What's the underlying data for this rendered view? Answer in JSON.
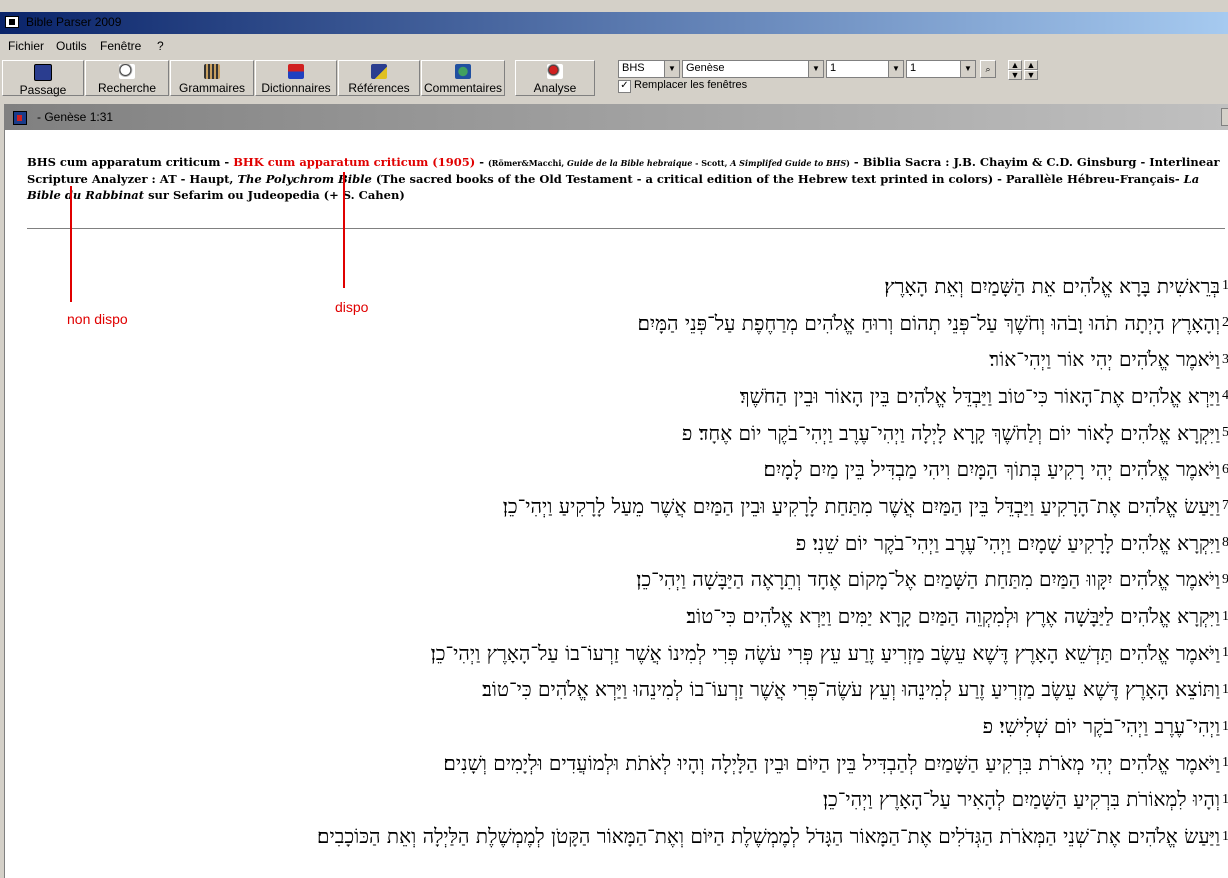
{
  "app": {
    "title": "Bible Parser 2009"
  },
  "menu": [
    "Fichier",
    "Outils",
    "Fenêtre",
    "?"
  ],
  "toolbar": {
    "buttons": [
      "Passage",
      "Recherche",
      "Grammaires",
      "Dictionnaires",
      "Références",
      "Commentaires",
      "Analyse"
    ],
    "version_select": "BHS",
    "book_select": "Genèse",
    "chapter_select": "1",
    "verse_select": "1",
    "replace_windows_label": "Remplacer les fenêtres",
    "replace_windows_checked": true
  },
  "document": {
    "title": "- Genèse 1:31",
    "sources": {
      "s1": "BHS cum apparatum criticum - ",
      "s2": "BHK cum apparatum criticum (1905)",
      "s3": " - ",
      "s4": "(Römer&Macchi, ",
      "s5": "Guide de la Bible hebraique",
      "s6": " - Scott, ",
      "s7": "A Simplifed Guide to BHS",
      "s8": ")",
      "s9": " - Biblia Sacra : J.B. Chayim & C.D. Ginsburg - Interlinear Scripture Analyzer : AT - Haupt, ",
      "s10": "The Polychrom Bible",
      "s11": " (The sacred books of the Old Testament - a critical edition of the Hebrew text printed in colors) - Parallèle Hébreu-Français- ",
      "s12": "La Bible du Rabbinat",
      "s13": " sur Sefarim ou Judeopedia (+ S. Cahen)"
    },
    "annotations": {
      "left": "non dispo",
      "right": "dispo"
    },
    "verses": [
      {
        "num": "1",
        "text": "בְּרֵאשִׁית בָּרָא אֱלֹהִים אֵת הַשָּׁמַיִם וְאֵת הָאָרֶץ׃"
      },
      {
        "num": "2",
        "text": "וְהָאָרֶץ הָיְתָה תֹהוּ וָבֹהוּ וְחֹשֶׁךְ עַל־פְּנֵי תְהוֹם וְרוּחַ אֱלֹהִים מְרַחֶפֶת עַל־פְּנֵי הַמָּיִם׃"
      },
      {
        "num": "3",
        "text": "וַיֹּאמֶר אֱלֹהִים יְהִי אוֹר וַיְהִי־אוֹר׃"
      },
      {
        "num": "4",
        "text": "וַיַּרְא אֱלֹהִים אֶת־הָאוֹר כִּי־טוֹב וַיַּבְדֵּל אֱלֹהִים בֵּין הָאוֹר וּבֵין הַחֹשֶׁךְ׃"
      },
      {
        "num": "5",
        "text": "וַיִּקְרָא אֱלֹהִים לָאוֹר יוֹם וְלַחֹשֶׁךְ קָרָא לָיְלָה וַיְהִי־עֶרֶב וַיְהִי־בֹקֶר יוֹם אֶחָד׃ פ"
      },
      {
        "num": "6",
        "text": "וַיֹּאמֶר אֱלֹהִים יְהִי רָקִיעַ בְּתוֹךְ הַמָּיִם וִיהִי מַבְדִּיל בֵּין מַיִם לָמָיִם׃"
      },
      {
        "num": "7",
        "text": "וַיַּעַשׂ אֱלֹהִים אֶת־הָרָקִיעַ וַיַּבְדֵּל בֵּין הַמַּיִם אֲשֶׁר מִתַּחַת לָרָקִיעַ וּבֵין הַמַּיִם אֲשֶׁר מֵעַל לָרָקִיעַ וַיְהִי־כֵן׃"
      },
      {
        "num": "8",
        "text": "וַיִּקְרָא אֱלֹהִים לָרָקִיעַ שָׁמָיִם וַיְהִי־עֶרֶב וַיְהִי־בֹקֶר יוֹם שֵׁנִי׃ פ"
      },
      {
        "num": "9",
        "text": "וַיֹּאמֶר אֱלֹהִים יִקָּווּ הַמַּיִם מִתַּחַת הַשָּׁמַיִם אֶל־מָקוֹם אֶחָד וְתֵרָאֶה הַיַּבָּשָׁה וַיְהִי־כֵן׃"
      },
      {
        "num": "1",
        "text": "וַיִּקְרָא אֱלֹהִים לַיַּבָּשָׁה אֶרֶץ וּלְמִקְוֵה הַמַּיִם קָרָא יַמִּים וַיַּרְא אֱלֹהִים כִּי־טוֹב׃"
      },
      {
        "num": "1",
        "text": "וַיֹּאמֶר אֱלֹהִים תַּדְשֵׁא הָאָרֶץ דֶּשֶׁא עֵשֶׂב מַזְרִיעַ זֶרַע עֵץ פְּרִי עֹשֶׂה פְּרִי לְמִינוֹ אֲשֶׁר זַרְעוֹ־בוֹ עַל־הָאָרֶץ וַיְהִי־כֵן׃"
      },
      {
        "num": "1",
        "text": "וַתּוֹצֵא הָאָרֶץ דֶּשֶׁא עֵשֶׂב מַזְרִיעַ זֶרַע לְמִינֵהוּ וְעֵץ עֹשֶׂה־פְּרִי אֲשֶׁר זַרְעוֹ־בוֹ לְמִינֵהוּ וַיַּרְא אֱלֹהִים כִּי־טוֹב׃"
      },
      {
        "num": "1",
        "text": "וַיְהִי־עֶרֶב וַיְהִי־בֹקֶר יוֹם שְׁלִישִׁי׃ פ"
      },
      {
        "num": "1",
        "text": "וַיֹּאמֶר אֱלֹהִים יְהִי מְאֹרֹת בִּרְקִיעַ הַשָּׁמַיִם לְהַבְדִּיל בֵּין הַיּוֹם וּבֵין הַלָּיְלָה וְהָיוּ לְאֹתֹת וּלְמוֹעֲדִים וּלְיָמִים וְשָׁנִים׃"
      },
      {
        "num": "1",
        "text": "וְהָיוּ לִמְאוֹרֹת בִּרְקִיעַ הַשָּׁמַיִם לְהָאִיר עַל־הָאָרֶץ וַיְהִי־כֵן׃"
      },
      {
        "num": "1",
        "text": "וַיַּעַשׂ אֱלֹהִים אֶת־שְׁנֵי הַמְּאֹרֹת הַגְּדֹלִים אֶת־הַמָּאוֹר הַגָּדֹל לְמֶמְשֶׁלֶת הַיּוֹם וְאֶת־הַמָּאוֹר הַקָּטֹן לְמֶמְשֶׁלֶת הַלַּיְלָה וְאֵת הַכּוֹכָבִים׃"
      }
    ]
  }
}
